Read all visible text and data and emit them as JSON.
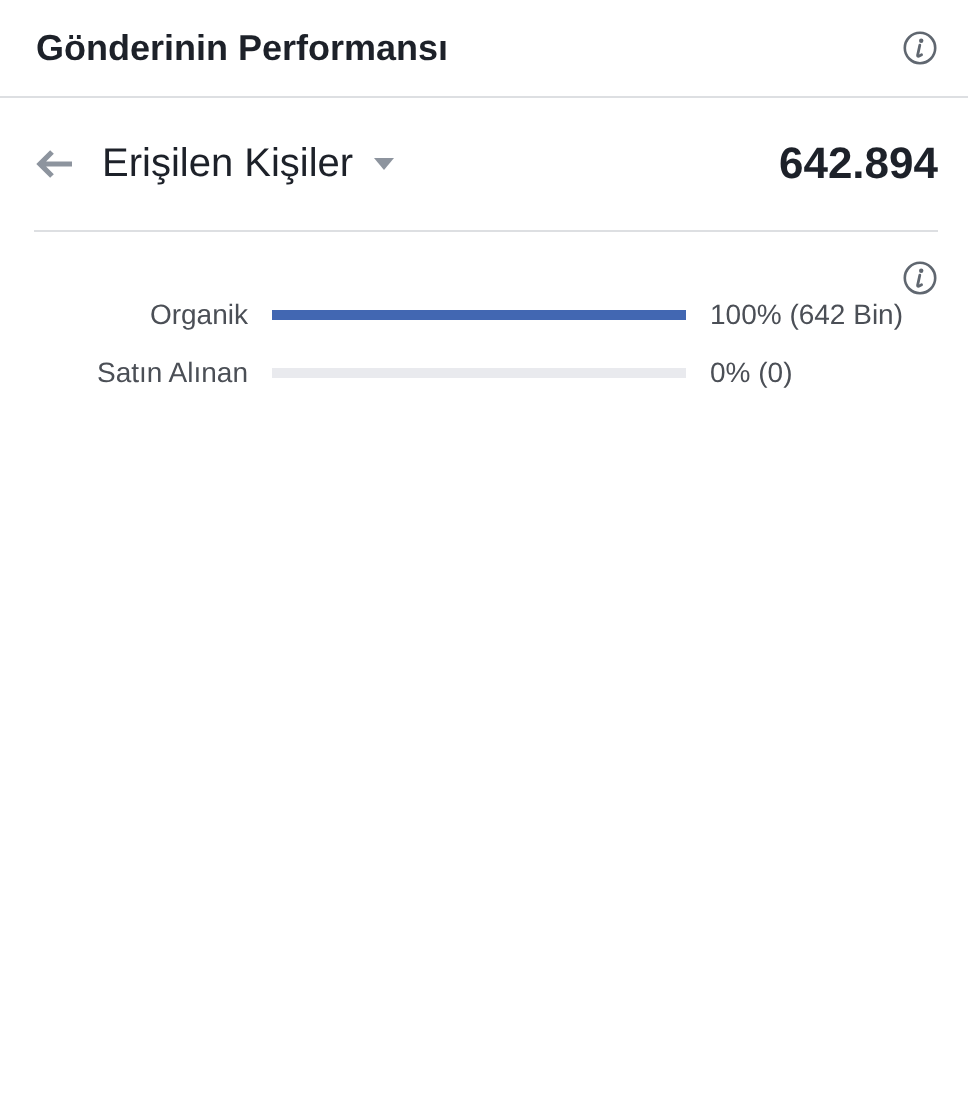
{
  "header": {
    "title": "Gönderinin Performansı"
  },
  "metric": {
    "label": "Erişilen Kişiler",
    "value": "642.894"
  },
  "breakdown": [
    {
      "label": "Organik",
      "level": 1.0,
      "reading": "100% (642 Bin)"
    },
    {
      "label": "Satın Alınan",
      "level": 0.0,
      "reading": "0% (0)"
    }
  ]
}
